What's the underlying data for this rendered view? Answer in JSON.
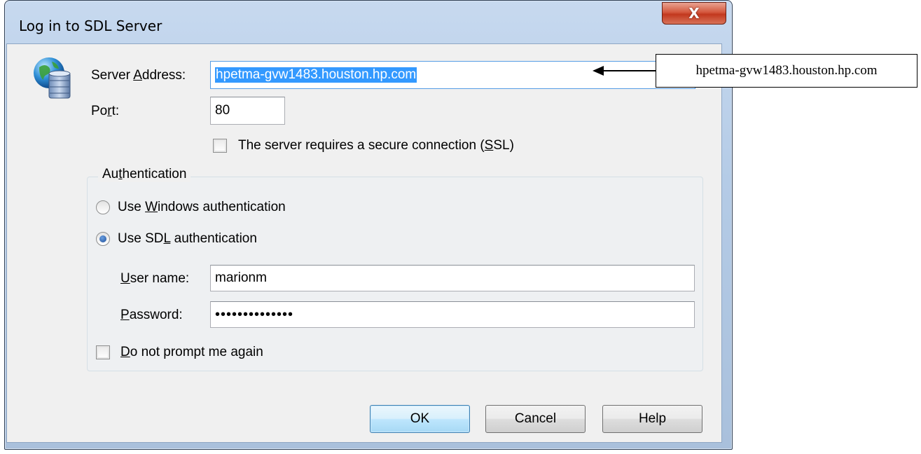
{
  "window": {
    "title": "Log in to SDL Server",
    "close_glyph": "X"
  },
  "server": {
    "address_label_pre": "Server ",
    "address_label_key": "A",
    "address_label_post": "ddress:",
    "address_value": "hpetma-gvw1483.houston.hp.com",
    "port_label_pre": "Po",
    "port_label_key": "r",
    "port_label_post": "t:",
    "port_value": "80",
    "ssl_label_pre": "The server requires a secure connection (",
    "ssl_label_key": "S",
    "ssl_label_post": "SL)",
    "ssl_checked": false
  },
  "auth": {
    "group_pre": "Au",
    "group_key": "t",
    "group_post": "hentication",
    "windows_pre": "Use ",
    "windows_key": "W",
    "windows_post": "indows authentication",
    "sdl_pre": "Use SD",
    "sdl_key": "L",
    "sdl_post": " authentication",
    "selected": "sdl",
    "username_key": "U",
    "username_post": "ser name:",
    "username_value": "marionm",
    "password_key": "P",
    "password_post": "assword:",
    "password_value": "••••••••••••••",
    "noprompt_key": "D",
    "noprompt_post": "o not prompt me again",
    "noprompt_checked": false
  },
  "buttons": {
    "ok": "OK",
    "cancel": "Cancel",
    "help": "Help"
  },
  "callout": {
    "text": "hpetma-gvw1483.houston.hp.com"
  },
  "icons": {
    "app": "server-globe-icon"
  }
}
